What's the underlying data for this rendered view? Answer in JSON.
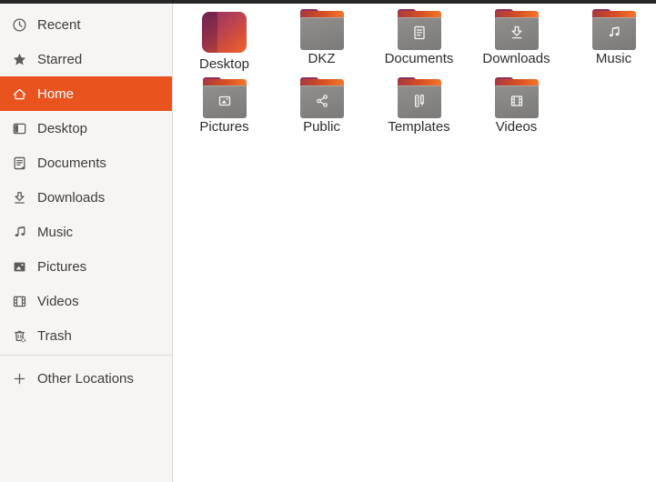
{
  "sidebar": {
    "selection_color": "#E9531E",
    "items": [
      {
        "label": "Recent",
        "icon": "clock-icon",
        "selected": false
      },
      {
        "label": "Starred",
        "icon": "star-icon",
        "selected": false
      },
      {
        "label": "Home",
        "icon": "home-icon",
        "selected": true
      },
      {
        "label": "Desktop",
        "icon": "desktop-window-icon",
        "selected": false
      },
      {
        "label": "Documents",
        "icon": "document-icon",
        "selected": false
      },
      {
        "label": "Downloads",
        "icon": "download-arrow-icon",
        "selected": false
      },
      {
        "label": "Music",
        "icon": "music-note-icon",
        "selected": false
      },
      {
        "label": "Pictures",
        "icon": "picture-icon",
        "selected": false
      },
      {
        "label": "Videos",
        "icon": "film-icon",
        "selected": false
      },
      {
        "label": "Trash",
        "icon": "trash-icon",
        "selected": false
      }
    ],
    "other_locations": {
      "label": "Other Locations",
      "icon": "plus-icon"
    }
  },
  "files": {
    "items": [
      {
        "label": "Desktop",
        "icon": "desktop-gradient-icon"
      },
      {
        "label": "DKZ",
        "icon": "folder-icon"
      },
      {
        "label": "Documents",
        "icon": "folder-document-icon"
      },
      {
        "label": "Downloads",
        "icon": "folder-download-icon"
      },
      {
        "label": "Music",
        "icon": "folder-music-icon"
      },
      {
        "label": "Pictures",
        "icon": "folder-image-icon"
      },
      {
        "label": "Public",
        "icon": "folder-share-icon"
      },
      {
        "label": "Templates",
        "icon": "folder-template-icon"
      },
      {
        "label": "Videos",
        "icon": "folder-film-icon"
      }
    ]
  },
  "colors": {
    "accent": "#E9531E",
    "topbar": "#262626",
    "sidebar_bg": "#F6F5F4",
    "folder_gray": "#858482",
    "folder_top_orange": "#E8561F",
    "folder_tab_maroon": "#8C2D50"
  }
}
